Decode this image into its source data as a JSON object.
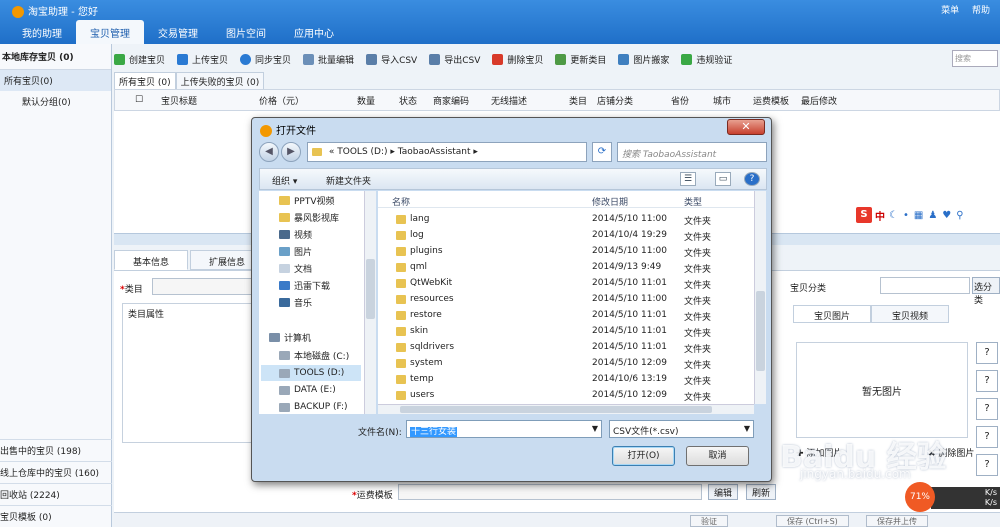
{
  "app": {
    "title": "淘宝助理 - 您好",
    "top_right": [
      "菜单",
      "帮助"
    ],
    "main_tabs": [
      "我的助理",
      "宝贝管理",
      "交易管理",
      "图片空间",
      "应用中心"
    ]
  },
  "left_panel": {
    "header": "本地库存宝贝 (0)",
    "items": [
      "所有宝贝(0)",
      "默认分组(0)"
    ],
    "bottom_items": [
      "出售中的宝贝 (198)",
      "线上仓库中的宝贝 (160)",
      "回收站 (2224)",
      "宝贝模板 (0)"
    ]
  },
  "toolbar": {
    "items": [
      "创建宝贝",
      "上传宝贝",
      "同步宝贝",
      "批量编辑",
      "导入CSV",
      "导出CSV",
      "删除宝贝",
      "更新类目",
      "图片搬家",
      "违规验证"
    ],
    "search_placeholder": "搜索"
  },
  "subtabs": [
    "所有宝贝 (0)",
    "上传失败的宝贝 (0)"
  ],
  "grid_columns": [
    "宝贝标题",
    "价格（元）",
    "数量",
    "状态",
    "商家编码",
    "无线描述",
    "类目",
    "店铺分类",
    "省份",
    "城市",
    "运费模板",
    "最后修改"
  ],
  "detail": {
    "tabs": [
      "基本信息",
      "扩展信息"
    ],
    "category_label": "类目",
    "attr_label": "类目属性",
    "shop_category_label": "宝贝分类",
    "select_category_button": "选分类",
    "image_tabs": [
      "宝贝图片",
      "宝贝视频"
    ],
    "no_image": "暂无图片",
    "add_image": "添加图片",
    "delete_image": "删除图片",
    "shipping_label": "运费模板",
    "edit_button": "编辑",
    "refresh_button": "刷新",
    "bottom_buttons": [
      "验证",
      "保存 (Ctrl+S)",
      "保存并上传"
    ]
  },
  "ime": {
    "zh": "中"
  },
  "speed": {
    "percent": "71%",
    "up": "K/s",
    "down": "K/s"
  },
  "watermark": {
    "main": "Baidu 经验",
    "sub": "jingyan.baidu.com"
  },
  "dialog": {
    "title": "打开文件",
    "path": [
      "«",
      "TOOLS (D:)",
      "TaobaoAssistant"
    ],
    "search_placeholder": "搜索 TaobaoAssistant",
    "organize": "组织 ▾",
    "new_folder": "新建文件夹",
    "nav_items": [
      "PPTV视频",
      "暴风影视库",
      "视频",
      "图片",
      "文档",
      "迅雷下载",
      "音乐",
      "计算机",
      "本地磁盘 (C:)",
      "TOOLS (D:)",
      "DATA (E:)",
      "BACKUP (F:)"
    ],
    "columns": [
      "名称",
      "修改日期",
      "类型"
    ],
    "files": [
      {
        "name": "lang",
        "date": "2014/5/10 11:00",
        "type": "文件夹"
      },
      {
        "name": "log",
        "date": "2014/10/4 19:29",
        "type": "文件夹"
      },
      {
        "name": "plugins",
        "date": "2014/5/10 11:00",
        "type": "文件夹"
      },
      {
        "name": "qml",
        "date": "2014/9/13 9:49",
        "type": "文件夹"
      },
      {
        "name": "QtWebKit",
        "date": "2014/5/10 11:01",
        "type": "文件夹"
      },
      {
        "name": "resources",
        "date": "2014/5/10 11:00",
        "type": "文件夹"
      },
      {
        "name": "restore",
        "date": "2014/5/10 11:01",
        "type": "文件夹"
      },
      {
        "name": "skin",
        "date": "2014/5/10 11:01",
        "type": "文件夹"
      },
      {
        "name": "sqldrivers",
        "date": "2014/5/10 11:01",
        "type": "文件夹"
      },
      {
        "name": "system",
        "date": "2014/5/10 12:09",
        "type": "文件夹"
      },
      {
        "name": "temp",
        "date": "2014/10/6 13:19",
        "type": "文件夹"
      },
      {
        "name": "users",
        "date": "2014/5/10 12:09",
        "type": "文件夹"
      }
    ],
    "filename_label": "文件名(N):",
    "filename_value": "十三行女装",
    "filetype": "CSV文件(*.csv)",
    "open_button": "打开(O)",
    "cancel_button": "取消"
  },
  "colors": {
    "header_blue": "#1f6fc8",
    "dialog_frame": "#c9dcf0",
    "close_red": "#c7402e"
  }
}
